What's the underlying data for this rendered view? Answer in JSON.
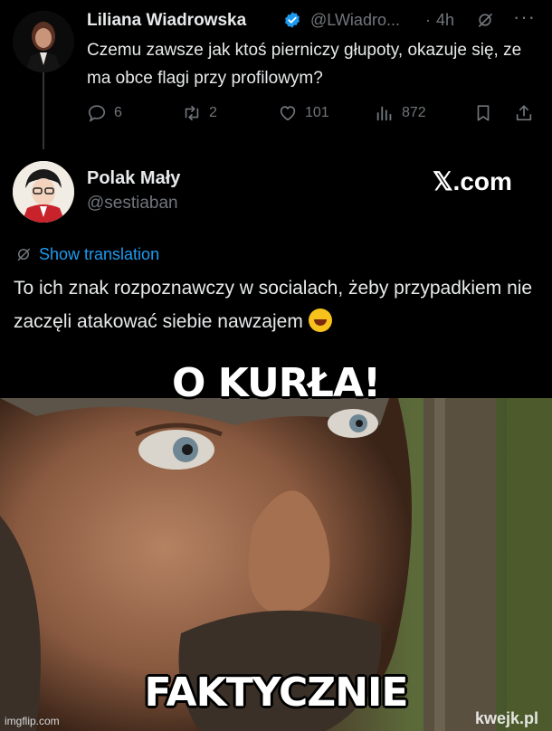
{
  "tweet1": {
    "name": "Liliana Wiadrowska",
    "handle": "@LWiadro...",
    "dot": "·",
    "time": "4h",
    "text": "Czemu zawsze jak ktoś pierniczy głupoty, okazuje się, ze ma obce flagi przy profilowym?",
    "replies": "6",
    "reposts": "2",
    "likes": "101",
    "views": "872"
  },
  "tweet2": {
    "name": "Polak Mały",
    "handle": "@sestiaban",
    "brand": "𝕏.com",
    "translate_label": "Show translation",
    "text": "To ich znak rozpoznawczy w socialach, żeby przypadkiem nie zaczęli atakować siebie nawzajem"
  },
  "meme": {
    "top_caption": "O KURŁA!",
    "bottom_caption": "FAKTYCZNIE",
    "imgflip": "imgflip.com",
    "kwejk": "kwejk.pl"
  },
  "icons": [
    "verified-badge-icon",
    "grok-icon",
    "more-icon",
    "reply-icon",
    "repost-icon",
    "like-icon",
    "views-icon",
    "bookmark-icon",
    "share-icon",
    "translate-icon",
    "laughing-emoji-icon"
  ],
  "colors": {
    "accent": "#1d9bf0",
    "muted": "#71767b",
    "text": "#e7e9ea",
    "background": "#000000"
  }
}
